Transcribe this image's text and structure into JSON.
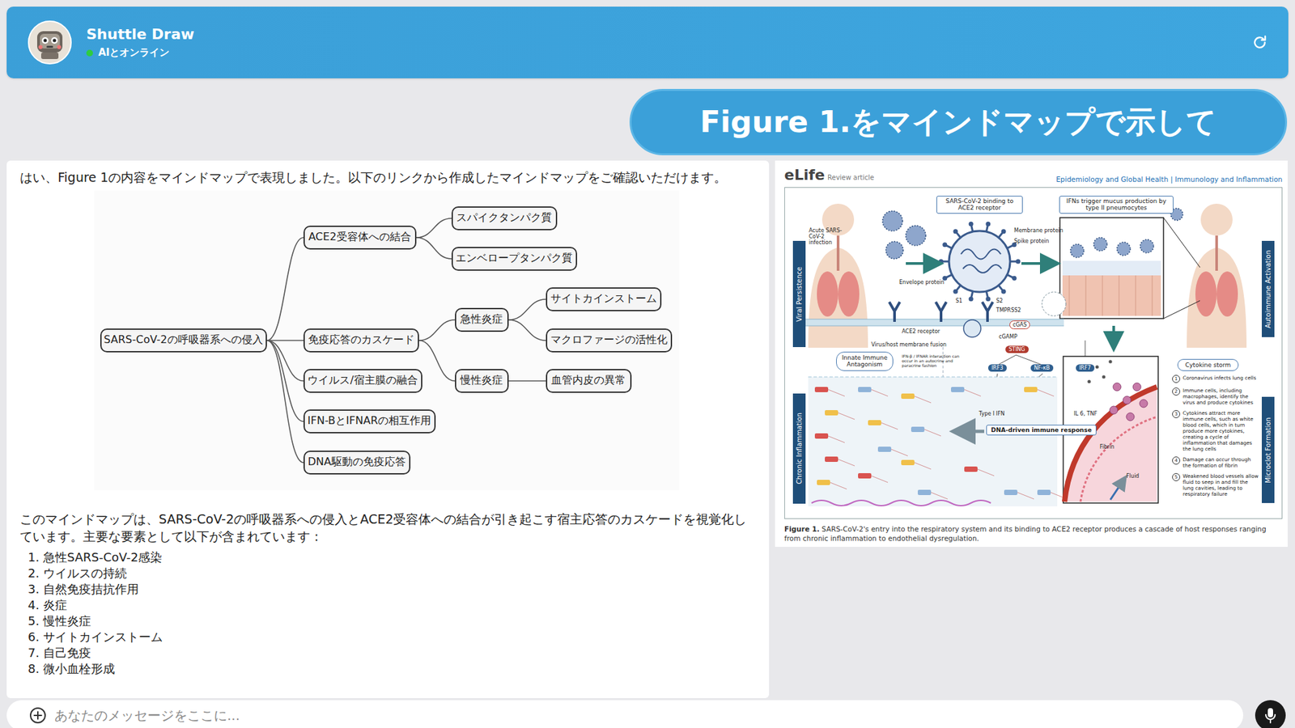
{
  "header": {
    "title": "Shuttle Draw",
    "status": "AIとオンライン",
    "online": true
  },
  "user_message": "Figure 1.をマインドマップで示して",
  "bot_message": {
    "intro": "はい、Figure 1の内容をマインドマップで表現しました。以下のリンクから作成したマインドマップをご確認いただけます。",
    "mindmap": {
      "label": "SARS-CoV-2の呼吸器系への侵入",
      "children": [
        {
          "label": "ACE2受容体への結合",
          "children": [
            {
              "label": "スパイクタンパク質",
              "children": []
            },
            {
              "label": "エンベロープタンパク質",
              "children": []
            }
          ]
        },
        {
          "label": "免疫応答のカスケード",
          "children": [
            {
              "label": "急性炎症",
              "children": [
                {
                  "label": "サイトカインストーム",
                  "children": []
                },
                {
                  "label": "マクロファージの活性化",
                  "children": []
                }
              ]
            },
            {
              "label": "慢性炎症",
              "children": [
                {
                  "label": "血管内皮の異常",
                  "children": []
                }
              ]
            }
          ]
        },
        {
          "label": "ウイルス/宿主膜の融合",
          "children": []
        },
        {
          "label": "IFN-BとIFNARの相互作用",
          "children": []
        },
        {
          "label": "DNA駆動の免疫応答",
          "children": []
        }
      ]
    },
    "summary": "このマインドマップは、SARS-CoV-2の呼吸器系への侵入とACE2受容体への結合が引き起こす宿主応答のカスケードを視覚化しています。主要な要素として以下が含まれています：",
    "items": [
      {
        "num": "1.",
        "text": "急性SARS-CoV-2感染"
      },
      {
        "num": "2.",
        "text": "ウイルスの持続"
      },
      {
        "num": "3.",
        "text": "自然免疫拮抗作用"
      },
      {
        "num": "4.",
        "text": "炎症"
      },
      {
        "num": "5.",
        "text": "慢性炎症"
      },
      {
        "num": "6.",
        "text": "サイトカインストーム"
      },
      {
        "num": "7.",
        "text": "自己免疫"
      },
      {
        "num": "8.",
        "text": "微小血栓形成"
      }
    ]
  },
  "paper": {
    "journal": "eLife",
    "type": "Review article",
    "subjects": "Epidemiology and Global Health | Immunology and Inflammation",
    "figure": {
      "side_labels": [
        {
          "text": "Viral Persistence",
          "side": "left"
        },
        {
          "text": "Chronic Inflammation",
          "side": "left"
        },
        {
          "text": "Autoimmune Activation",
          "side": "right"
        },
        {
          "text": "Microclot Formation",
          "side": "right"
        }
      ],
      "labels": {
        "acute": "Acute SARS-CoV-2 infection",
        "binding": "SARS-CoV-2 binding to ACE2 receptor",
        "mucus": "IFNs trigger mucus production by type II pneumocytes",
        "membrane": "Membrane protein",
        "spike": "Spike protein",
        "envelope": "Envelope protein",
        "s1": "S1",
        "s2": "S2",
        "ace2": "ACE2 receptor",
        "tmprss2": "TMPRSS2",
        "fusion": "Virus/host membrane fusion",
        "cgas": "cGAS",
        "cgamp": "cGAMP",
        "sting": "STING",
        "antagonism": "Innate Immune Antagonism",
        "ifnar": "IFN-β / IFNAR interaction can occur in an autocrine and paracrine fashion",
        "irf3": "IRF3",
        "nfkb": "NF-κB",
        "irf7": "IRF7",
        "type1": "Type I IFN",
        "il6": "IL 6, TNF",
        "dna": "DNA-driven immune response",
        "fibrin": "Fibrin",
        "fluid": "Fluid"
      },
      "storm": {
        "title": "Cytokine storm",
        "steps": [
          {
            "num": "1",
            "text": "Coronavirus infects lung cells"
          },
          {
            "num": "2",
            "text": "Immune cells, including macrophages, identify the virus and produce cytokines"
          },
          {
            "num": "3",
            "text": "Cytokines attract more immune cells, such as white blood cells, which in turn produce more cytokines, creating a cycle of inflammation that damages the lung cells"
          },
          {
            "num": "4",
            "text": "Damage can occur through the formation of fibrin"
          },
          {
            "num": "5",
            "text": "Weakened blood vessels allow fluid to seep in and fill the lung cavities, leading to respiratory failure"
          }
        ]
      }
    },
    "caption_label": "Figure 1.",
    "caption": "SARS-CoV-2's entry into the respiratory system and its binding to ACE2 receptor produces a cascade of host responses ranging from chronic inflammation to endothelial dysregulation."
  },
  "input": {
    "placeholder": "あなたのメッセージをここに..."
  }
}
